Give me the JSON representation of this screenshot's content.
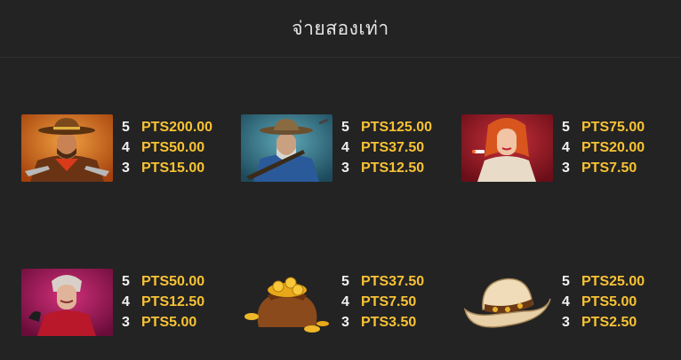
{
  "header": {
    "title": "จ่ายสองเท่า"
  },
  "symbols": [
    {
      "icon": "cowboy-gunslinger-icon",
      "pays": [
        {
          "count": "5",
          "value": "PTS200.00"
        },
        {
          "count": "4",
          "value": "PTS50.00"
        },
        {
          "count": "3",
          "value": "PTS15.00"
        }
      ]
    },
    {
      "icon": "old-prospector-icon",
      "pays": [
        {
          "count": "5",
          "value": "PTS125.00"
        },
        {
          "count": "4",
          "value": "PTS37.50"
        },
        {
          "count": "3",
          "value": "PTS12.50"
        }
      ]
    },
    {
      "icon": "redhead-woman-icon",
      "pays": [
        {
          "count": "5",
          "value": "PTS75.00"
        },
        {
          "count": "4",
          "value": "PTS20.00"
        },
        {
          "count": "3",
          "value": "PTS7.50"
        }
      ]
    },
    {
      "icon": "old-lady-icon",
      "pays": [
        {
          "count": "5",
          "value": "PTS50.00"
        },
        {
          "count": "4",
          "value": "PTS12.50"
        },
        {
          "count": "3",
          "value": "PTS5.00"
        }
      ]
    },
    {
      "icon": "gold-sack-icon",
      "pays": [
        {
          "count": "5",
          "value": "PTS37.50"
        },
        {
          "count": "4",
          "value": "PTS7.50"
        },
        {
          "count": "3",
          "value": "PTS3.50"
        }
      ]
    },
    {
      "icon": "cowboy-hat-icon",
      "pays": [
        {
          "count": "5",
          "value": "PTS25.00"
        },
        {
          "count": "4",
          "value": "PTS5.00"
        },
        {
          "count": "3",
          "value": "PTS2.50"
        }
      ]
    }
  ],
  "colors": {
    "background": "#232323",
    "value": "#f8c235",
    "count": "#f2f2f2",
    "title": "#e6e6e6"
  }
}
